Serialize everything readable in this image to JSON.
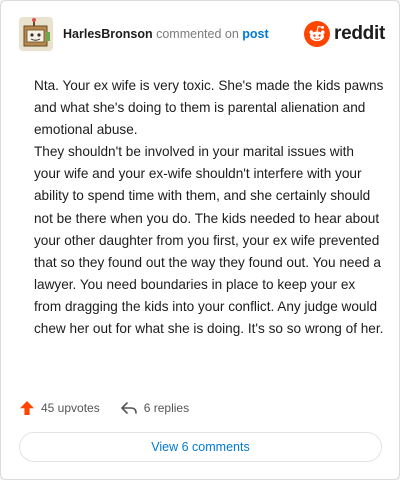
{
  "comment": {
    "username": "HarlesBronson",
    "action": "commented on",
    "target": "post",
    "paragraphs": [
      "Nta. Your ex wife is very toxic. She's made the kids pawns and what she's doing to them is parental alienation and emotional abuse.",
      "They shouldn't be involved in your marital issues with your wife and your ex-wife shouldn't interfere with your ability to spend time with them, and she certainly should not be there when you do. The kids needed to hear about your other daughter from you first, your ex wife prevented that so they found out the way they found out. You need a lawyer. You need boundaries in place to keep your ex from dragging the kids into your conflict. Any judge would chew her out for what she is doing. It's so so wrong of her."
    ]
  },
  "brand": {
    "wordmark": "reddit",
    "icon": "reddit-snoo-icon"
  },
  "footer": {
    "upvotes": "45 upvotes",
    "upvote_icon": "upvote-arrow-icon",
    "replies": "6 replies",
    "reply_icon": "reply-arrow-icon",
    "view_comments": "View 6 comments"
  },
  "colors": {
    "brand_orange": "#ff4500",
    "link_blue": "#0079d3",
    "text": "#1c1c1c",
    "muted": "#7c7c7c"
  }
}
